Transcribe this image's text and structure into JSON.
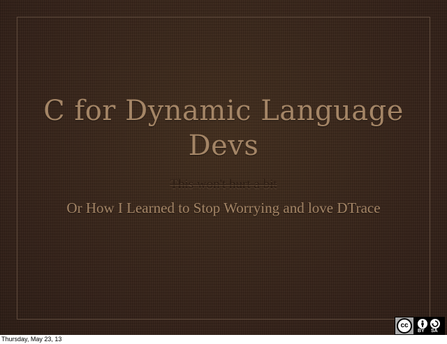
{
  "slide": {
    "title": "C for Dynamic Language Devs",
    "struck_subtitle": "This won't hurt a bit",
    "subtitle": "Or How I Learned to Stop Worrying and love DTrace"
  },
  "license": {
    "logo_text": "cc",
    "by_label": "BY",
    "sa_label": "SA",
    "icons": [
      "creative-commons-icon",
      "attribution-icon",
      "share-alike-icon"
    ]
  },
  "footer": {
    "timestamp": "Thursday, May 23, 13"
  },
  "colors": {
    "background": "#3a261a",
    "title_text": "#a48566",
    "struck_text": "#2a1b12",
    "frame": "#5e4a3c"
  }
}
